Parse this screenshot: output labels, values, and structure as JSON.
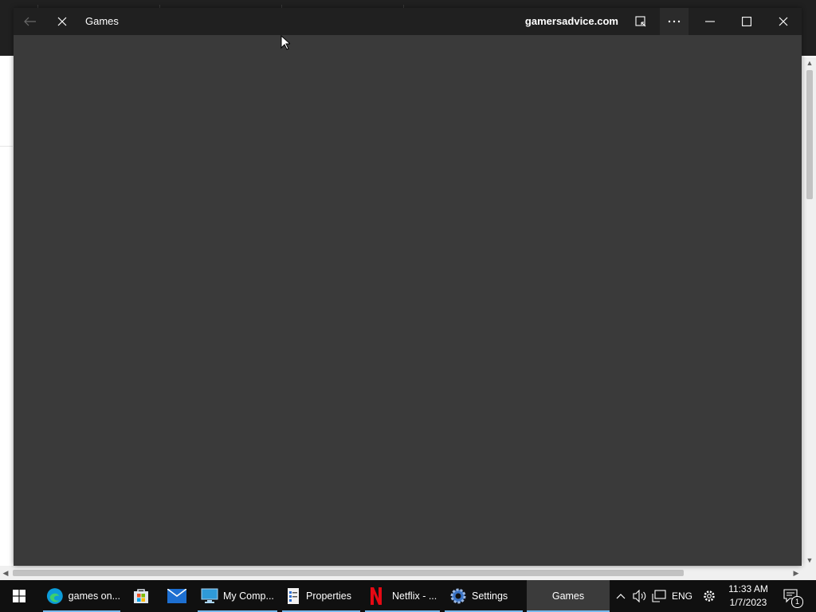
{
  "window": {
    "title": "Games",
    "domain": "gamersadvice.com"
  },
  "taskbar": {
    "items": [
      {
        "label": "games on..."
      },
      {
        "label": "My Comp..."
      },
      {
        "label": "Properties"
      },
      {
        "label": "Netflix - ..."
      },
      {
        "label": "Settings"
      },
      {
        "label": "Games"
      }
    ],
    "language": "ENG",
    "time": "11:33 AM",
    "date": "1/7/2023",
    "notification_count": "1"
  },
  "colors": {
    "titlebar": "#202020",
    "content": "#3a3a3a",
    "taskbar": "#101010",
    "active_indicator": "#76b9ed",
    "netflix": "#e50914",
    "edge": "#0c9bd8",
    "mail": "#1d6fd1"
  },
  "icons": [
    "back-arrow-icon",
    "close-icon",
    "reading-mode-icon",
    "more-icon",
    "minimize-icon",
    "maximize-icon",
    "windows-start-icon",
    "edge-icon",
    "microsoft-store-icon",
    "mail-icon",
    "computer-icon",
    "properties-icon",
    "netflix-icon",
    "settings-gear-icon",
    "chevron-up-icon",
    "volume-icon",
    "network-icon",
    "gear-icon",
    "notification-icon"
  ]
}
